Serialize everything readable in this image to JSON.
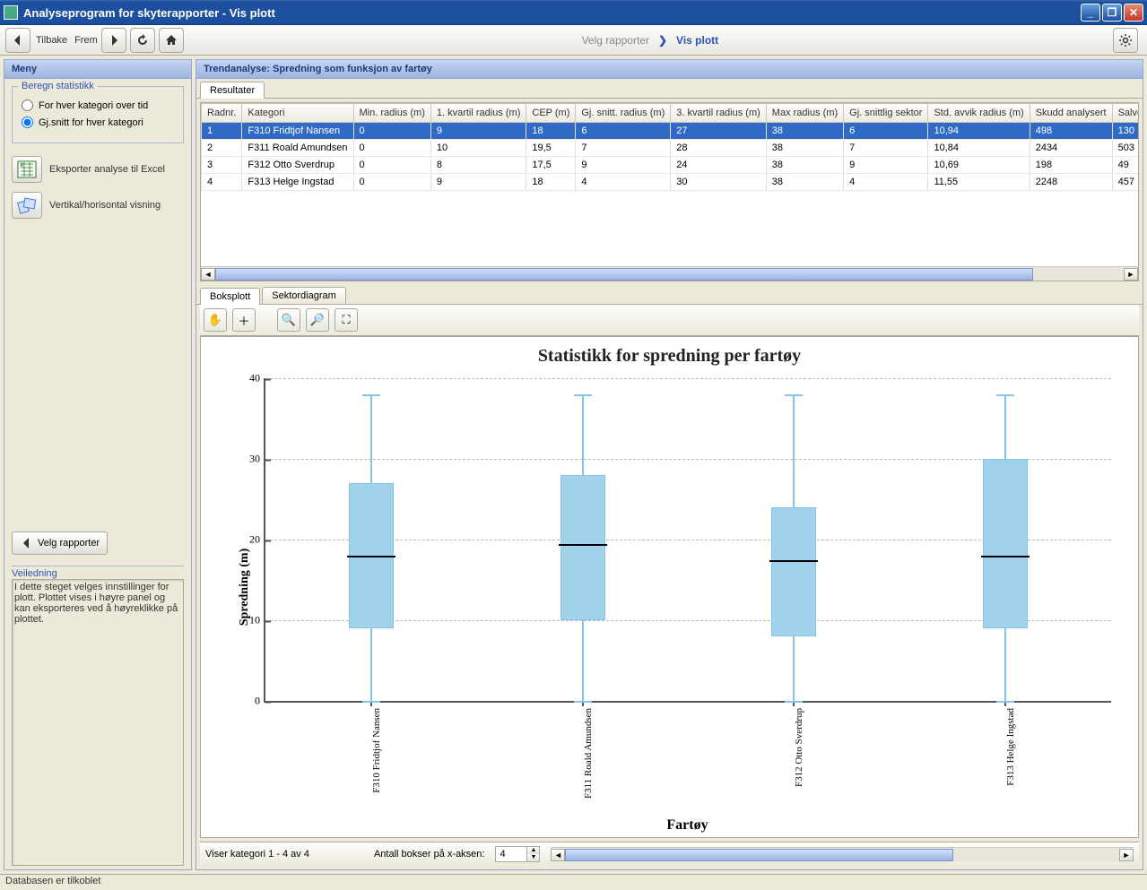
{
  "window": {
    "title": "Analyseprogram for skyterapporter - Vis plott"
  },
  "toolbar": {
    "back_label": "Tilbake",
    "forward_label": "Frem"
  },
  "breadcrumb": {
    "prev": "Velg rapporter",
    "current": "Vis plott"
  },
  "sidebar": {
    "header": "Meny",
    "stat_legend": "Beregn statistikk",
    "radio1": "For hver kategori over tid",
    "radio2": "Gj.snitt for hver kategori",
    "action_export": "Eksporter analyse til Excel",
    "action_orient": "Vertikal/horisontal visning",
    "velg_label": "Velg rapporter",
    "veil_legend": "Veiledning",
    "veil_text": "I dette steget velges innstillinger for plott. Plottet vises i høyre panel og kan eksporteres ved å høyreklikke på plottet."
  },
  "content": {
    "header": "Trendanalyse: Spredning som funksjon av fartøy",
    "tab_results": "Resultater",
    "tab_boxplot": "Boksplott",
    "tab_sector": "Sektordiagram"
  },
  "table": {
    "columns": [
      "Radnr.",
      "Kategori",
      "Min. radius (m)",
      "1. kvartil radius (m)",
      "CEP (m)",
      "Gj. snitt. radius (m)",
      "3. kvartil radius (m)",
      "Max radius (m)",
      "Gj. snittlig sektor",
      "Std. avvik radius (m)",
      "Skudd analysert",
      "Salve analy"
    ],
    "rows": [
      {
        "n": "1",
        "kat": "F310 Fridtjof Nansen",
        "min": "0",
        "q1": "9",
        "cep": "18",
        "mean": "6",
        "q3": "27",
        "max": "38",
        "sek": "6",
        "std": "10,94",
        "skudd": "498",
        "salve": "130"
      },
      {
        "n": "2",
        "kat": "F311 Roald Amundsen",
        "min": "0",
        "q1": "10",
        "cep": "19,5",
        "mean": "7",
        "q3": "28",
        "max": "38",
        "sek": "7",
        "std": "10,84",
        "skudd": "2434",
        "salve": "503"
      },
      {
        "n": "3",
        "kat": "F312 Otto Sverdrup",
        "min": "0",
        "q1": "8",
        "cep": "17,5",
        "mean": "9",
        "q3": "24",
        "max": "38",
        "sek": "9",
        "std": "10,69",
        "skudd": "198",
        "salve": "49"
      },
      {
        "n": "4",
        "kat": "F313 Helge Ingstad",
        "min": "0",
        "q1": "9",
        "cep": "18",
        "mean": "4",
        "q3": "30",
        "max": "38",
        "sek": "4",
        "std": "11,55",
        "skudd": "2248",
        "salve": "457"
      }
    ]
  },
  "chart_data": {
    "type": "boxplot",
    "title": "Statistikk for spredning per fartøy",
    "xlabel": "Fartøy",
    "ylabel": "Spredning (m)",
    "ylim": [
      0,
      40
    ],
    "yticks": [
      0,
      10,
      20,
      30,
      40
    ],
    "categories": [
      "F310 Fridtjof Nansen",
      "F311 Roald Amundsen",
      "F312 Otto Sverdrup",
      "F313 Helge Ingstad"
    ],
    "series": [
      {
        "min": 0,
        "q1": 9,
        "median": 18,
        "q3": 27,
        "max": 38
      },
      {
        "min": 0,
        "q1": 10,
        "median": 19.5,
        "q3": 28,
        "max": 38
      },
      {
        "min": 0,
        "q1": 8,
        "median": 17.5,
        "q3": 24,
        "max": 38
      },
      {
        "min": 0,
        "q1": 9,
        "median": 18,
        "q3": 30,
        "max": 38
      }
    ]
  },
  "footer": {
    "status_left": "Viser kategori 1 - 4 av 4",
    "spinner_label": "Antall bokser på x-aksen:",
    "spinner_value": "4"
  },
  "statusbar": {
    "text": "Databasen er tilkoblet"
  }
}
